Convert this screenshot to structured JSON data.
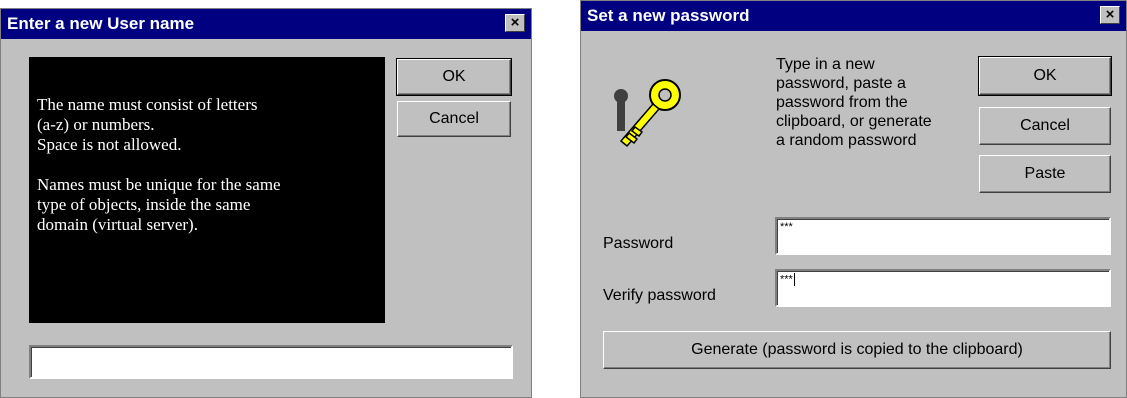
{
  "user_dialog": {
    "title": "Enter a new User name",
    "close_label": "×",
    "ok_label": "OK",
    "cancel_label": "Cancel",
    "info_paragraph_1_line_1": "The name must consist of letters",
    "info_paragraph_1_line_2": "(a-z) or numbers.",
    "info_paragraph_1_line_3": "Space is not allowed.",
    "info_paragraph_2_line_1": "Names must be unique for the same",
    "info_paragraph_2_line_2": "type of objects, inside the same",
    "info_paragraph_2_line_3": "domain (virtual server).",
    "name_input_value": ""
  },
  "password_dialog": {
    "title": "Set a new password",
    "close_label": "×",
    "instructions_line_1": "Type in a new",
    "instructions_line_2": "password, paste a",
    "instructions_line_3": "password from the",
    "instructions_line_4": "clipboard, or generate",
    "instructions_line_5": "a random password",
    "ok_label": "OK",
    "cancel_label": "Cancel",
    "paste_label": "Paste",
    "password_label": "Password",
    "password_value": "***",
    "verify_label": "Verify password",
    "verify_value": "***",
    "generate_label": "Generate (password is copied to the clipboard)",
    "key_icon": "key-icon"
  }
}
